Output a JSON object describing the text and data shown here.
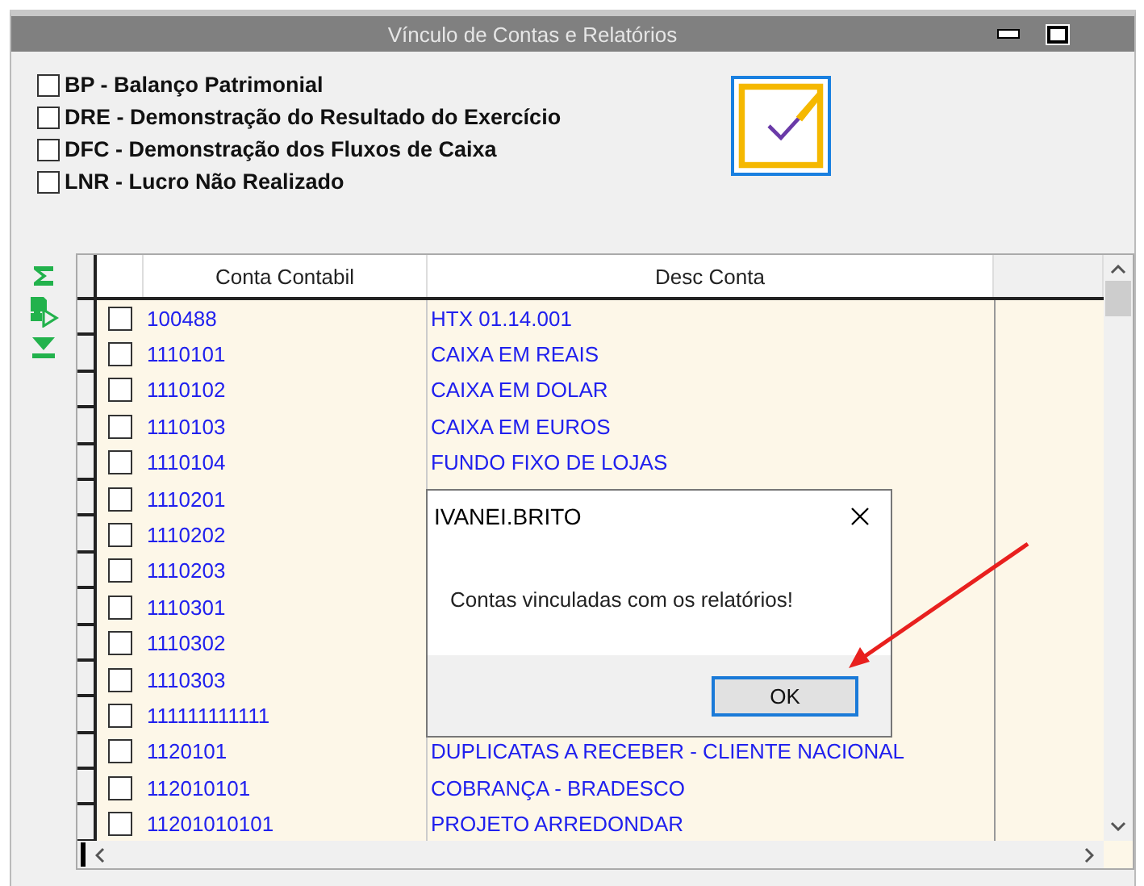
{
  "window": {
    "title": "Vínculo de Contas e Relatórios"
  },
  "reports": [
    {
      "label": "BP - Balanço Patrimonial",
      "checked": false
    },
    {
      "label": "DRE - Demonstração do Resultado do Exercício",
      "checked": false
    },
    {
      "label": "DFC - Demonstração dos Fluxos de Caixa",
      "checked": false
    },
    {
      "label": "LNR - Lucro Não Realizado",
      "checked": false
    }
  ],
  "table": {
    "columns": [
      "Conta Contabil",
      "Desc Conta"
    ],
    "rows": [
      {
        "account": "100488",
        "desc": "HTX 01.14.001",
        "checked": false
      },
      {
        "account": "1110101",
        "desc": "CAIXA EM REAIS",
        "checked": false
      },
      {
        "account": "1110102",
        "desc": "CAIXA EM DOLAR",
        "checked": false
      },
      {
        "account": "1110103",
        "desc": "CAIXA EM EUROS",
        "checked": false
      },
      {
        "account": "1110104",
        "desc": "FUNDO FIXO DE LOJAS",
        "checked": false
      },
      {
        "account": "1110201",
        "checked": false
      },
      {
        "account": "1110202",
        "checked": false
      },
      {
        "account": "1110203",
        "checked": false
      },
      {
        "account": "1110301",
        "checked": false
      },
      {
        "account": "1110302",
        "checked": false
      },
      {
        "account": "1110303",
        "checked": false
      },
      {
        "account": "111111111111",
        "checked": false
      },
      {
        "account": "1120101",
        "desc": "DUPLICATAS A RECEBER - CLIENTE NACIONAL",
        "checked": false
      },
      {
        "account": "112010101",
        "desc": "COBRANÇA - BRADESCO",
        "checked": false
      },
      {
        "account": "11201010101",
        "desc": "PROJETO ARREDONDAR",
        "checked": false
      }
    ]
  },
  "dialog": {
    "title": "IVANEI.BRITO",
    "message": "Contas vinculadas com os relatórios!",
    "button": "OK"
  }
}
